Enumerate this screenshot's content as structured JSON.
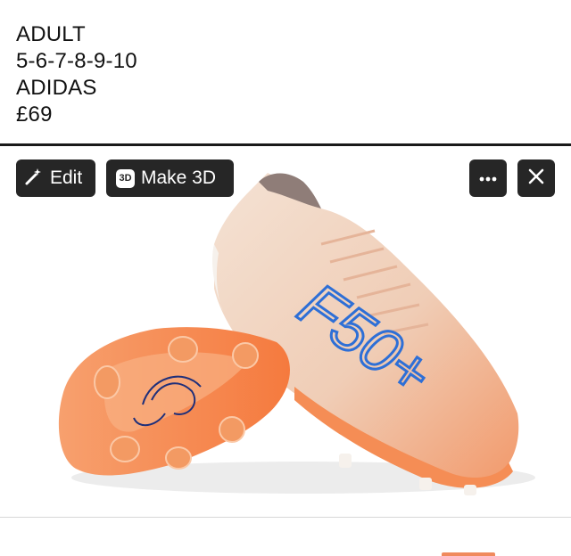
{
  "caption": {
    "lines": [
      "ADULT",
      "5-6-7-8-9-10",
      "ADIDAS",
      "£69"
    ]
  },
  "toolbar": {
    "edit_label": "Edit",
    "make3d_label": "Make 3D",
    "make3d_badge": "3D",
    "more_icon": "ellipsis-icon",
    "close_icon": "close-icon"
  },
  "photo": {
    "shoe_logo_text": "F50+",
    "colors": {
      "upper": "#f1d6c3",
      "soleplate": "#f7884f",
      "logo": "#2e6fd6"
    }
  }
}
